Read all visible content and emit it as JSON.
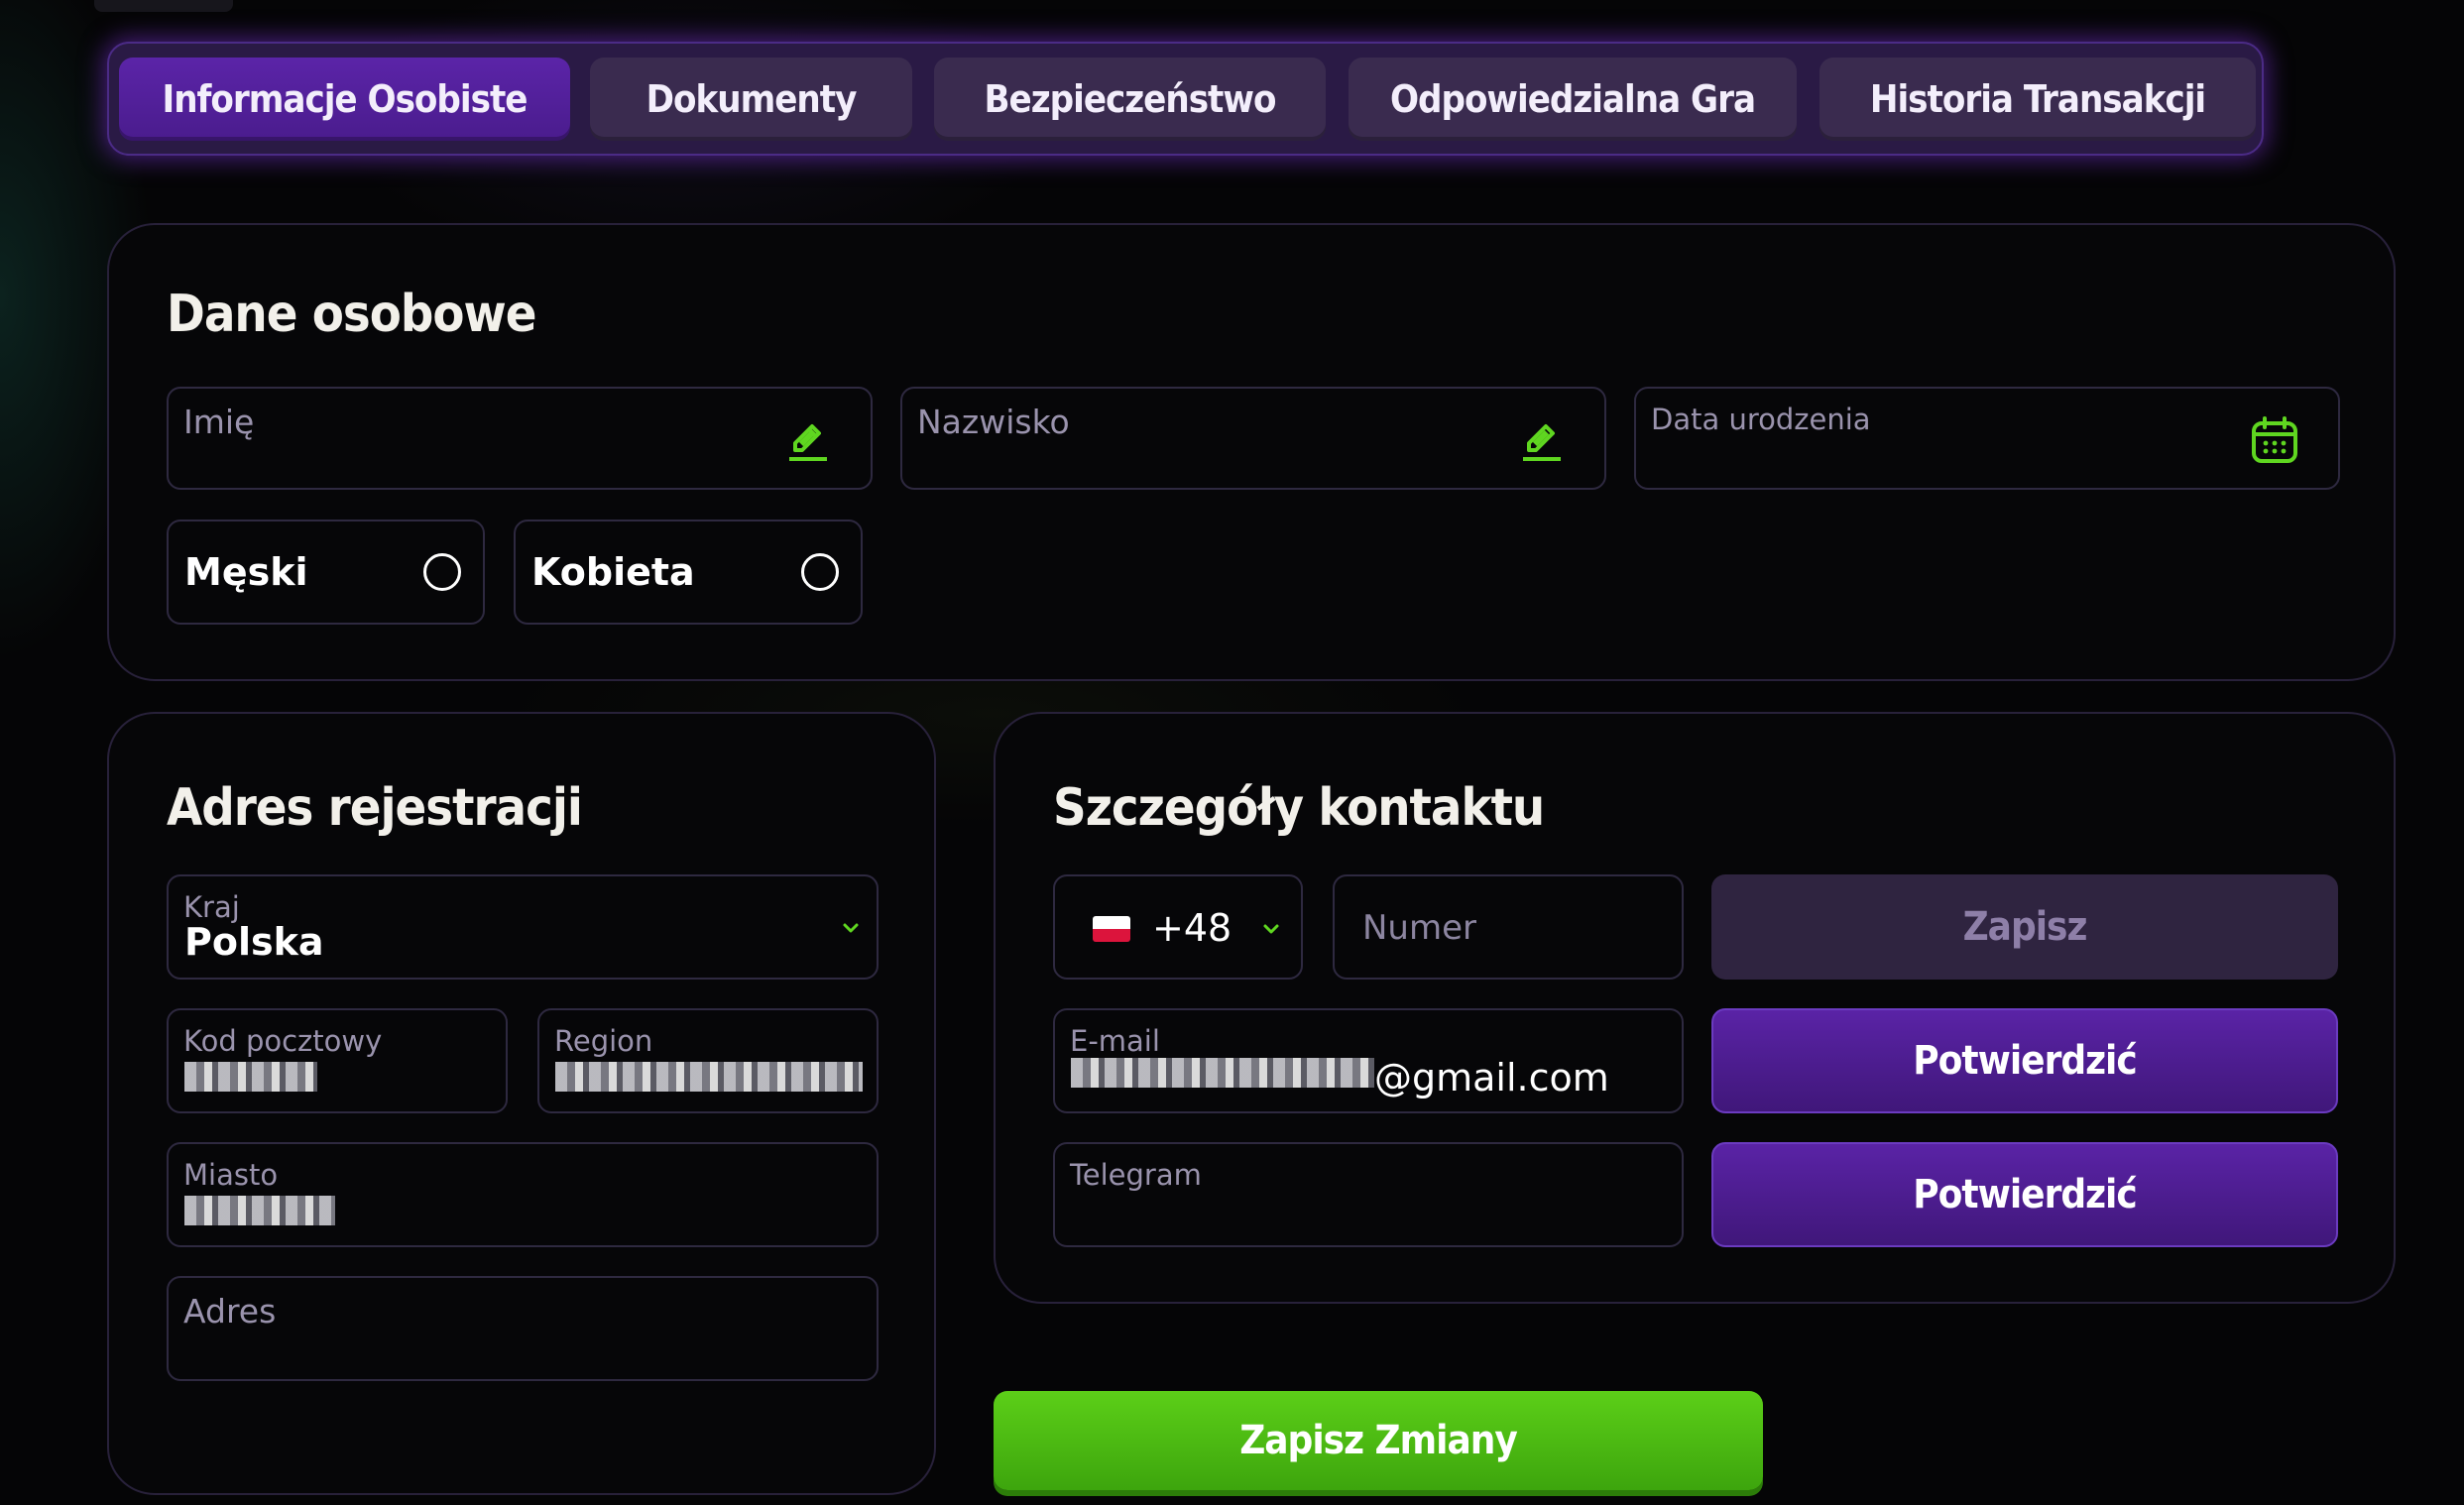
{
  "tabs": [
    {
      "label": "Informacje Osobiste",
      "active": true
    },
    {
      "label": "Dokumenty",
      "active": false
    },
    {
      "label": "Bezpieczeństwo",
      "active": false
    },
    {
      "label": "Odpowiedzialna Gra",
      "active": false
    },
    {
      "label": "Historia Transakcji",
      "active": false
    }
  ],
  "personal": {
    "title": "Dane osobowe",
    "first_name_label": "Imię",
    "last_name_label": "Nazwisko",
    "birthdate_label": "Data urodzenia",
    "gender_male": "Męski",
    "gender_female": "Kobieta"
  },
  "address": {
    "title": "Adres rejestracji",
    "country_label": "Kraj",
    "country_value": "Polska",
    "postal_label": "Kod pocztowy",
    "region_label": "Region",
    "city_label": "Miasto",
    "address_label": "Adres"
  },
  "contact": {
    "title": "Szczegóły kontaktu",
    "phone_code": "+48",
    "phone_placeholder": "Numer",
    "save_label": "Zapisz",
    "email_label": "E-mail",
    "email_suffix": "@gmail.com",
    "confirm_email_label": "Potwierdzić",
    "telegram_label": "Telegram",
    "confirm_telegram_label": "Potwierdzić"
  },
  "footer": {
    "save_changes_label": "Zapisz Zmiany"
  },
  "colors": {
    "accent_purple": "#5a23a6",
    "accent_green": "#4cbf12",
    "icon_green": "#5fd620"
  },
  "icons": {
    "edit": "pencil-icon",
    "calendar": "calendar-icon",
    "dropdown": "chevron-down-icon",
    "flag": "poland-flag-icon"
  }
}
